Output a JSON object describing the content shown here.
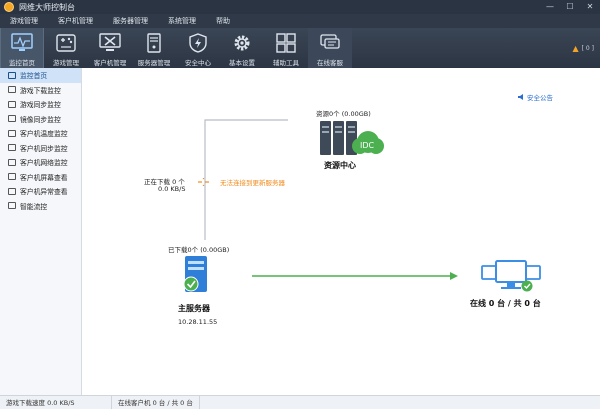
{
  "window": {
    "title": "网维大师控制台",
    "min_label": "—",
    "max_label": "☐",
    "close_label": "✕"
  },
  "menu": [
    "游戏管理",
    "客户机管理",
    "服务器管理",
    "系统管理",
    "帮助"
  ],
  "toolbar": {
    "items": [
      {
        "label": "监控首页",
        "icon": "monitor-icon"
      },
      {
        "label": "游戏管理",
        "icon": "gamepad-icon"
      },
      {
        "label": "客户机管理",
        "icon": "client-tools-icon"
      },
      {
        "label": "服务器管理",
        "icon": "server-icon"
      },
      {
        "label": "安全中心",
        "icon": "shield-icon"
      },
      {
        "label": "基本设置",
        "icon": "gear-icon"
      },
      {
        "label": "辅助工具",
        "icon": "grid-icon"
      },
      {
        "label": "在线客服",
        "icon": "chat-icon"
      }
    ],
    "right_text": "[ 0 ]"
  },
  "sidebar": {
    "items": [
      "监控首页",
      "游戏下载监控",
      "游戏同步监控",
      "镜像同步监控",
      "客户机温度监控",
      "客户机同步监控",
      "客户机网络监控",
      "客户机屏幕查看",
      "客户机异常查看",
      "智能流控"
    ]
  },
  "main": {
    "notice": "安全公告",
    "resource": {
      "count_label": "资源0个 (0.00GB)",
      "name": "资源中心",
      "badge": "IDC"
    },
    "download": {
      "status": "正在下载 0 个",
      "speed": "0.0 KB/S"
    },
    "link_warning": "无法连接到更新服务器",
    "server": {
      "downloaded_label": "已下载0个 (0.00GB)",
      "name": "主服务器",
      "ip": "10.28.11.55"
    },
    "clients": {
      "label": "在线 0 台 / 共 0 台"
    }
  },
  "statusbar": {
    "download_speed": "游戏下载速度 0.0 KB/S",
    "online_clients": "在线客户机 0 台 / 共 0 台"
  },
  "colors": {
    "accent_green": "#4caf50",
    "warn_orange": "#f08a1a",
    "link_blue": "#2a6fd0",
    "toolbar_bg": "#2c3543"
  }
}
